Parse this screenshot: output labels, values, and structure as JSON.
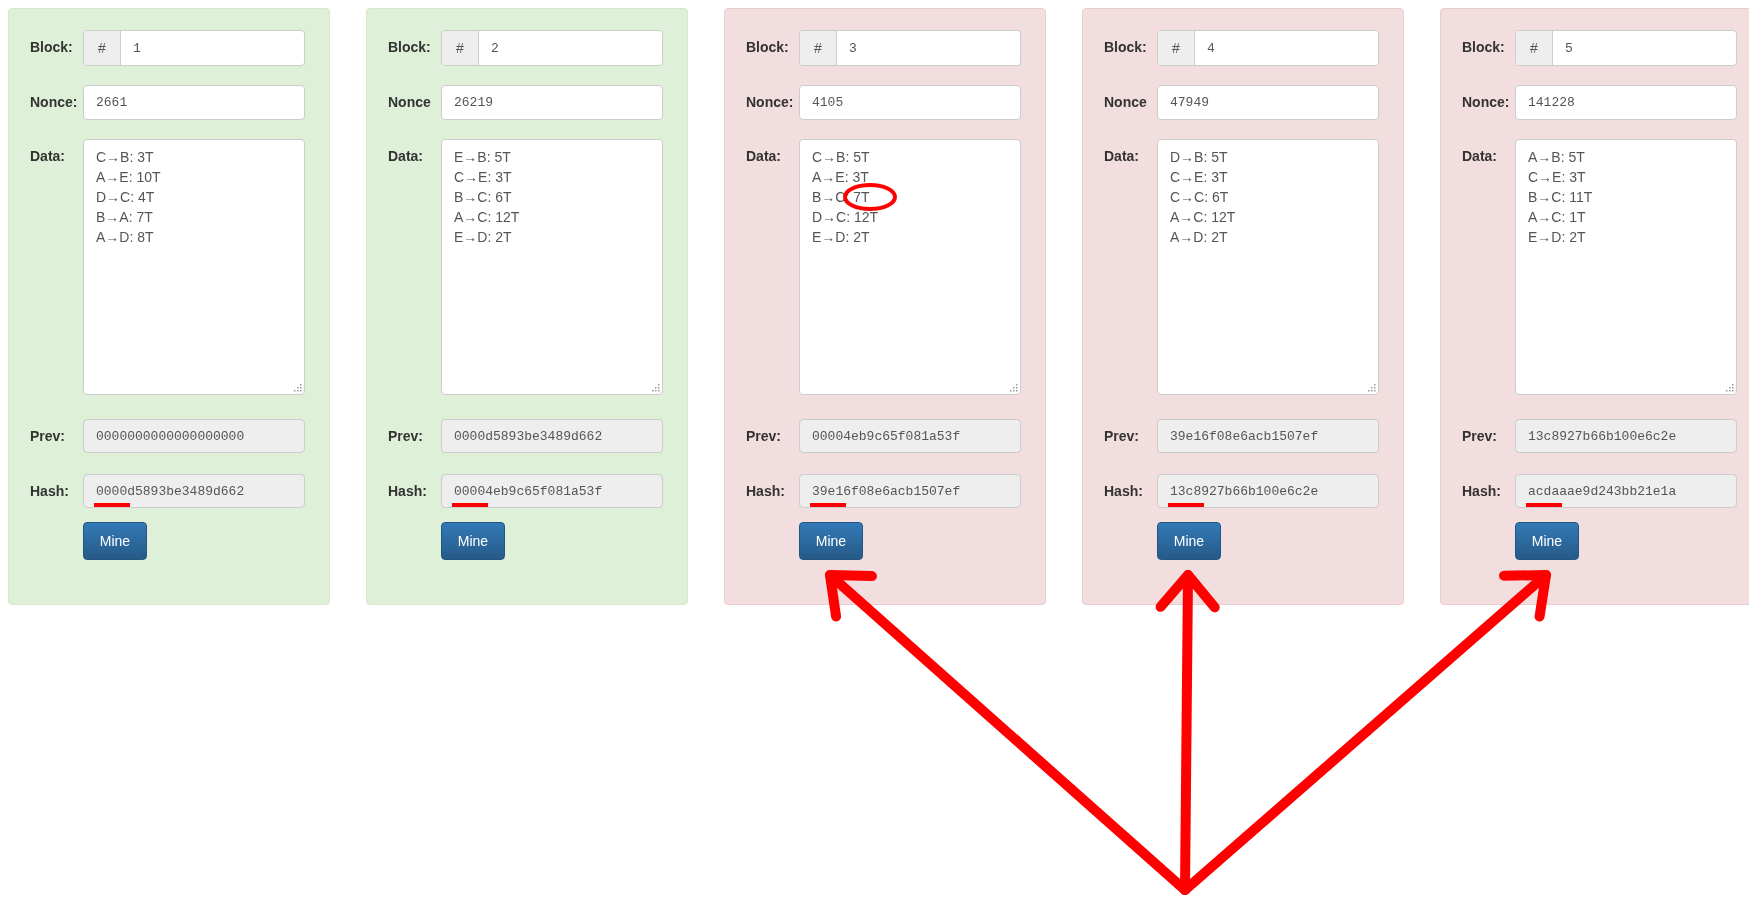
{
  "blocks": [
    {
      "valid": true,
      "labels": {
        "block": "Block:",
        "nonce": "Nonce:",
        "data": "Data:",
        "prev": "Prev:",
        "hash": "Hash:"
      },
      "addon": "#",
      "block": "1",
      "nonce": "2661",
      "data": [
        {
          "text": "C→B: 3T",
          "circled": false
        },
        {
          "text": "A→E: 10T",
          "circled": false
        },
        {
          "text": "D→C: 4T",
          "circled": false
        },
        {
          "text": "B→A: 7T",
          "circled": false
        },
        {
          "text": "A→D: 8T",
          "circled": false
        }
      ],
      "prev": "0000000000000000000",
      "hash": "0000d5893be3489d662",
      "hash_underlined": true,
      "button": "Mine",
      "arrow_to_button": false
    },
    {
      "valid": true,
      "labels": {
        "block": "Block:",
        "nonce": "Nonce",
        "data": "Data:",
        "prev": "Prev:",
        "hash": "Hash:"
      },
      "addon": "#",
      "block": "2",
      "nonce": "26219",
      "data": [
        {
          "text": "E→B: 5T",
          "circled": false
        },
        {
          "text": "C→E: 3T",
          "circled": false
        },
        {
          "text": "B→C: 6T",
          "circled": false
        },
        {
          "text": "A→C: 12T",
          "circled": false
        },
        {
          "text": "E→D: 2T",
          "circled": false
        }
      ],
      "prev": "0000d5893be3489d662",
      "hash": "00004eb9c65f081a53f",
      "hash_underlined": true,
      "button": "Mine",
      "arrow_to_button": false
    },
    {
      "valid": false,
      "labels": {
        "block": "Block:",
        "nonce": "Nonce:",
        "data": "Data:",
        "prev": "Prev:",
        "hash": "Hash:"
      },
      "addon": "#",
      "block": "3",
      "nonce": "4105",
      "data": [
        {
          "text": "C→B: 5T",
          "circled": false
        },
        {
          "text": "A→E: 3T",
          "circled": false
        },
        {
          "text": "B→C: 7T",
          "circled": true
        },
        {
          "text": "D→C: 12T",
          "circled": false
        },
        {
          "text": "E→D: 2T",
          "circled": false
        }
      ],
      "prev": "00004eb9c65f081a53f",
      "hash": "39e16f08e6acb1507ef",
      "hash_underlined": true,
      "button": "Mine",
      "arrow_to_button": true
    },
    {
      "valid": false,
      "labels": {
        "block": "Block:",
        "nonce": "Nonce",
        "data": "Data:",
        "prev": "Prev:",
        "hash": "Hash:"
      },
      "addon": "#",
      "block": "4",
      "nonce": "47949",
      "data": [
        {
          "text": "D→B: 5T",
          "circled": false
        },
        {
          "text": "C→E: 3T",
          "circled": false
        },
        {
          "text": "C→C: 6T",
          "circled": false
        },
        {
          "text": "A→C: 12T",
          "circled": false
        },
        {
          "text": "A→D: 2T",
          "circled": false
        }
      ],
      "prev": "39e16f08e6acb1507ef",
      "hash": "13c8927b66b100e6c2e",
      "hash_underlined": true,
      "button": "Mine",
      "arrow_to_button": true
    },
    {
      "valid": false,
      "labels": {
        "block": "Block:",
        "nonce": "Nonce:",
        "data": "Data:",
        "prev": "Prev:",
        "hash": "Hash:"
      },
      "addon": "#",
      "block": "5",
      "nonce": "141228",
      "data": [
        {
          "text": "A→B: 5T",
          "circled": false
        },
        {
          "text": "C→E: 3T",
          "circled": false
        },
        {
          "text": "B→C: 11T",
          "circled": false
        },
        {
          "text": "A→C: 1T",
          "circled": false
        },
        {
          "text": "E→D: 2T",
          "circled": false
        }
      ],
      "prev": "13c8927b66b100e6c2e",
      "hash": "acdaaae9d243bb21e1a",
      "hash_underlined": true,
      "button": "Mine",
      "arrow_to_button": true
    }
  ]
}
